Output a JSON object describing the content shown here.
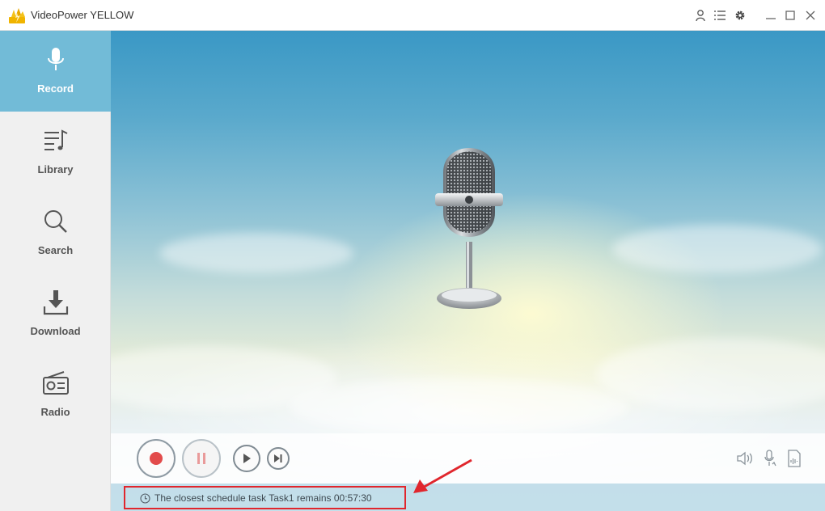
{
  "window": {
    "title": "VideoPower YELLOW"
  },
  "titlebar_icons": [
    "user-icon",
    "list-icon",
    "gear-icon",
    "minimize-icon",
    "maximize-icon",
    "close-icon"
  ],
  "sidebar": {
    "items": [
      {
        "label": "Record",
        "icon": "microphone-icon",
        "active": true
      },
      {
        "label": "Library",
        "icon": "music-list-icon",
        "active": false
      },
      {
        "label": "Search",
        "icon": "search-icon",
        "active": false
      },
      {
        "label": "Download",
        "icon": "download-icon",
        "active": false
      },
      {
        "label": "Radio",
        "icon": "radio-icon",
        "active": false
      }
    ]
  },
  "controls": {
    "buttons": [
      "record-icon",
      "pause-icon",
      "play-icon",
      "next-icon"
    ],
    "right_icons": [
      "volume-icon",
      "mic-settings-icon",
      "audio-file-icon"
    ]
  },
  "status": {
    "text": "The closest schedule task Task1 remains 00:57:30"
  },
  "colors": {
    "accent": "#72bbd7",
    "record_red": "#e24b4b",
    "annotation_red": "#e0262d"
  }
}
